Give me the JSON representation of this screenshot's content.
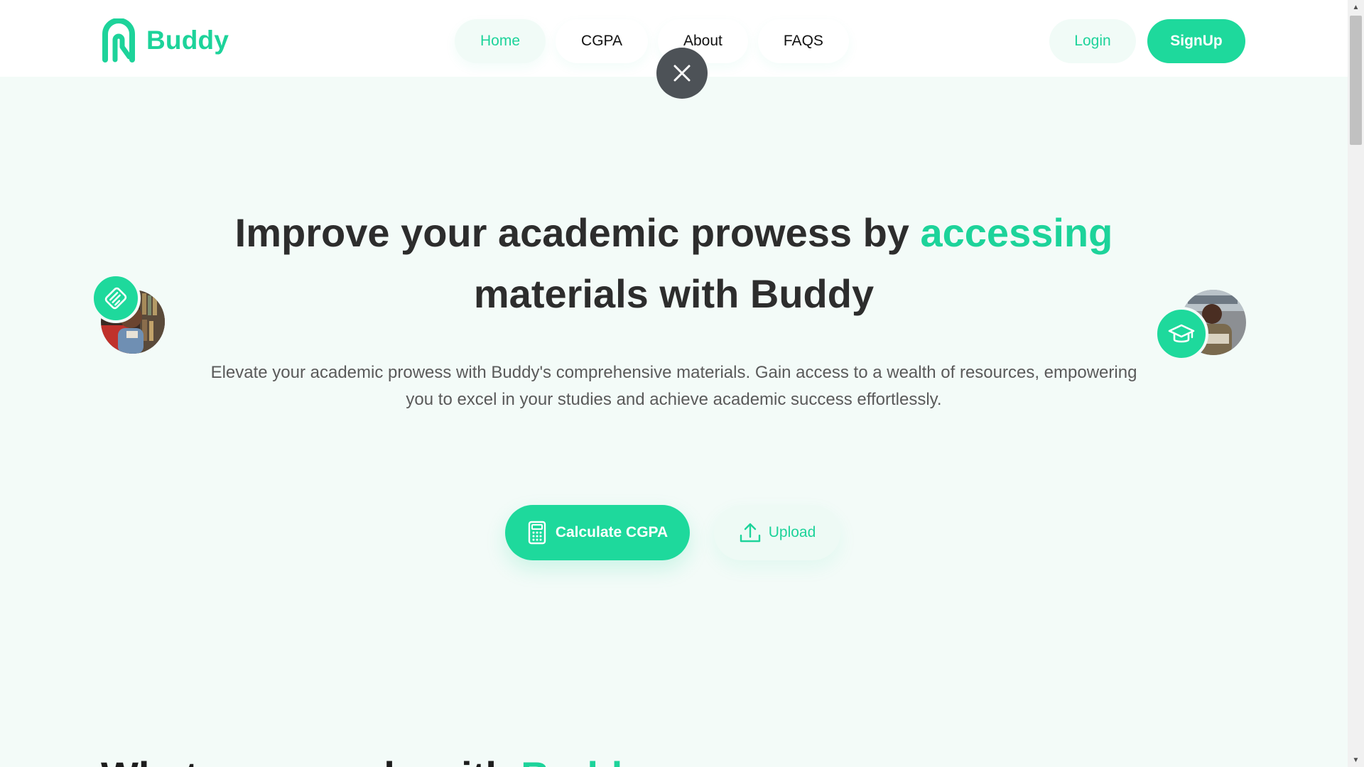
{
  "brand": {
    "name": "Buddy",
    "color": "#1dd39a"
  },
  "nav": {
    "items": [
      {
        "label": "Home",
        "active": true
      },
      {
        "label": "CGPA",
        "active": false
      },
      {
        "label": "About",
        "active": false
      },
      {
        "label": "FAQS",
        "active": false
      }
    ]
  },
  "auth": {
    "login_label": "Login",
    "signup_label": "SignUp"
  },
  "overlay": {
    "close_icon": "close-icon"
  },
  "hero": {
    "title_part1": "Improve your academic prowess by ",
    "title_accent": "accessing",
    "title_part2": "materials with Buddy",
    "subtitle": "Elevate your academic prowess with Buddy's comprehensive materials. Gain access to a wealth of resources, empowering you to excel in your studies and achieve academic success effortlessly.",
    "primary_cta": {
      "label": "Calculate CGPA",
      "icon": "calculator-icon"
    },
    "secondary_cta": {
      "label": "Upload",
      "icon": "upload-icon"
    }
  },
  "floating": {
    "left": {
      "badge_icon": "book-icon",
      "photo": "student-photo-left"
    },
    "right": {
      "badge_icon": "graduation-cap-icon",
      "photo": "student-photo-right"
    }
  },
  "next_section": {
    "title_part1": "What you can do with ",
    "title_accent": "Buddy"
  }
}
